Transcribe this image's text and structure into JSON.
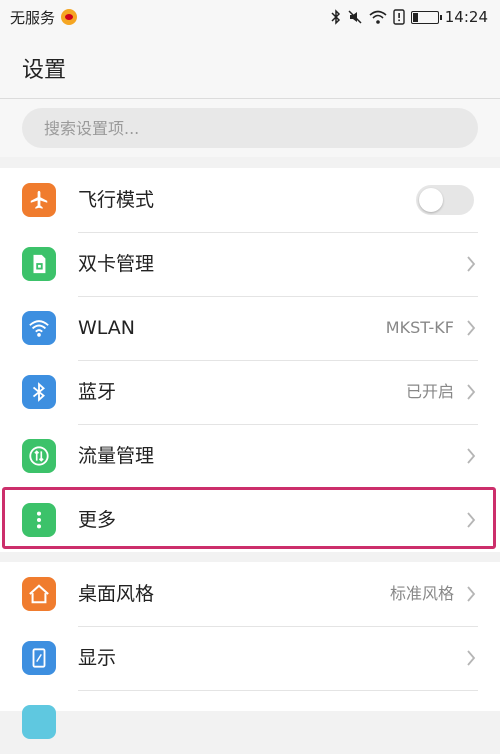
{
  "status_bar": {
    "carrier": "无服务",
    "time": "14:24",
    "icons": [
      "weibo-icon",
      "bluetooth-icon",
      "mute-icon",
      "wifi-icon",
      "alert-icon",
      "battery-icon"
    ]
  },
  "header": {
    "title": "设置"
  },
  "search": {
    "placeholder": "搜索设置项..."
  },
  "colors": {
    "airplane": "#f07c2e",
    "sim": "#3cc26a",
    "wlan": "#3d8fe0",
    "bluetooth": "#3d8fe0",
    "traffic": "#3cc26a",
    "more": "#3cc26a",
    "theme": "#f07c2e",
    "display": "#3d8fe0",
    "highlight": "#cc2f6b"
  },
  "settings": {
    "group1": [
      {
        "label": "飞行模式",
        "icon": "airplane-icon",
        "control": "toggle",
        "toggle_on": false
      },
      {
        "label": "双卡管理",
        "icon": "sim-card-icon",
        "control": "chevron"
      },
      {
        "label": "WLAN",
        "icon": "wifi-icon",
        "value": "MKST-KF",
        "control": "chevron"
      },
      {
        "label": "蓝牙",
        "icon": "bluetooth-icon",
        "value": "已开启",
        "control": "chevron"
      },
      {
        "label": "流量管理",
        "icon": "traffic-icon",
        "control": "chevron"
      },
      {
        "label": "更多",
        "icon": "more-dots-icon",
        "control": "chevron",
        "highlighted": true
      }
    ],
    "group2": [
      {
        "label": "桌面风格",
        "icon": "home-icon",
        "value": "标准风格",
        "control": "chevron"
      },
      {
        "label": "显示",
        "icon": "display-icon",
        "control": "chevron"
      }
    ]
  }
}
